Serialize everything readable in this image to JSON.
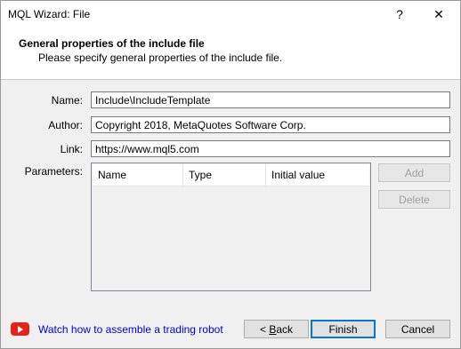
{
  "window": {
    "title": "MQL Wizard: File",
    "help_glyph": "?",
    "close_glyph": "✕"
  },
  "header": {
    "title": "General properties of the include file",
    "subtitle": "Please specify general properties of the include file."
  },
  "form": {
    "name_label": "Name:",
    "name_value": "Include\\IncludeTemplate",
    "author_label": "Author:",
    "author_value": "Copyright 2018, MetaQuotes Software Corp.",
    "link_label": "Link:",
    "link_value": "https://www.mql5.com",
    "parameters_label": "Parameters:"
  },
  "parameters_table": {
    "columns": [
      "Name",
      "Type",
      "Initial value"
    ],
    "rows": []
  },
  "side_buttons": {
    "add": "Add",
    "delete": "Delete"
  },
  "footer": {
    "video_icon": "youtube-play-icon",
    "video_link": "Watch how to assemble a trading robot",
    "back_prefix": "< ",
    "back_accel": "B",
    "back_rest": "ack",
    "finish": "Finish",
    "cancel": "Cancel"
  },
  "colors": {
    "link": "#0000cc",
    "youtube_red": "#e62117",
    "default_button_border": "#0078d7"
  }
}
